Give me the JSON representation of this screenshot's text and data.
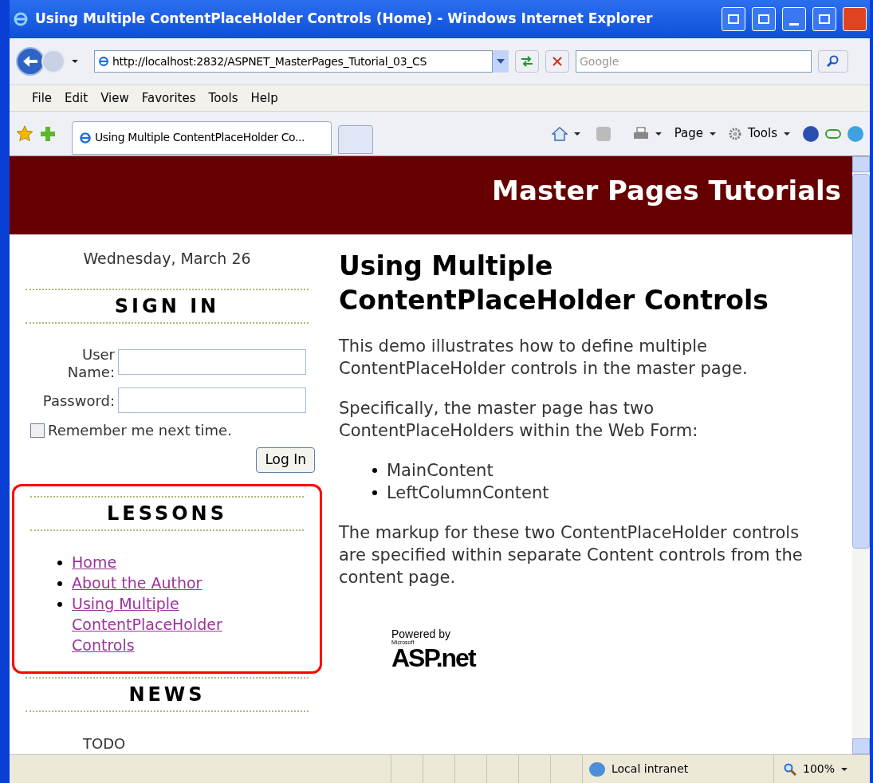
{
  "window": {
    "title": "Using Multiple ContentPlaceHolder Controls (Home) - Windows Internet Explorer"
  },
  "address_bar": {
    "url": "http://localhost:2832/ASPNET_MasterPages_Tutorial_03_CS",
    "search_placeholder": "Google"
  },
  "menu": [
    "File",
    "Edit",
    "View",
    "Favorites",
    "Tools",
    "Help"
  ],
  "tab": {
    "title": "Using Multiple ContentPlaceHolder Co..."
  },
  "command_bar": [
    "Page",
    "Tools"
  ],
  "page": {
    "header": "Master Pages Tutorials",
    "date": "Wednesday, March 26",
    "sign_in": {
      "heading": "SIGN IN",
      "user_label": "User Name:",
      "password_label": "Password:",
      "remember": {
        "label": "Remember me next time.",
        "checked": false
      },
      "button": "Log In"
    },
    "lessons": {
      "heading": "LESSONS",
      "highlighted": true,
      "links": [
        "Home",
        "About the Author",
        "Using Multiple ContentPlaceHolder Controls"
      ]
    },
    "news": {
      "heading": "NEWS",
      "text": "TODO"
    },
    "main": {
      "heading": "Using Multiple ContentPlaceHolder Controls",
      "paragraphs": [
        "This demo illustrates how to define multiple ContentPlaceHolder controls in the master page.",
        "Specifically, the master page has two ContentPlaceHolders within the Web Form:"
      ],
      "list": [
        "MainContent",
        "LeftColumnContent"
      ],
      "closing": "The markup for these two ContentPlaceHolder controls are specified within separate Content controls from the content page.",
      "powered_by": "Powered by",
      "logo_small": "Microsoft",
      "logo": "ASP.net"
    }
  },
  "status_bar": {
    "zone": "Local intranet",
    "zoom": "100%"
  }
}
